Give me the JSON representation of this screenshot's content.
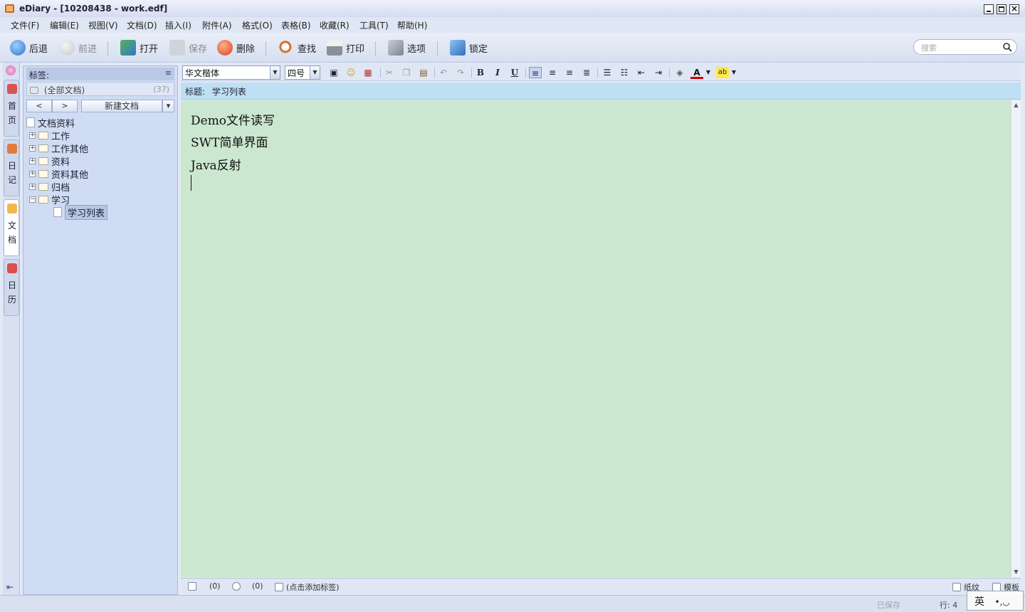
{
  "window": {
    "title": "eDiary - [10208438 - work.edf]"
  },
  "menu": [
    "文件(F)",
    "编辑(E)",
    "视图(V)",
    "文档(D)",
    "插入(I)",
    "附件(A)",
    "格式(O)",
    "表格(B)",
    "收藏(R)",
    "工具(T)",
    "帮助(H)"
  ],
  "toolbar": {
    "back": "后退",
    "forward": "前进",
    "open": "打开",
    "save": "保存",
    "delete": "删除",
    "find": "查找",
    "print": "打印",
    "options": "选项",
    "lock": "锁定",
    "search_placeholder": "搜索"
  },
  "left_tabs": {
    "home": "首页",
    "diary": "日记",
    "docs": "文档",
    "calendar": "日历"
  },
  "sidebar": {
    "tags_label": "标签:",
    "all_docs": "(全部文档)",
    "all_docs_count": "(37)",
    "nav_back": "<",
    "nav_forward": ">",
    "new_doc": "新建文档",
    "tree_root": "文档资料",
    "folders": [
      "工作",
      "工作其他",
      "资料",
      "资料其他",
      "归档",
      "学习"
    ],
    "selected_doc": "学习列表"
  },
  "editor_toolbar": {
    "font": "华文楷体",
    "size": "四号"
  },
  "doc": {
    "title_label": "标题:",
    "title": "学习列表",
    "lines": [
      "Demo文件读写",
      "SWT简单界面",
      "Java反射"
    ]
  },
  "doc_footer": {
    "attachments": "(0)",
    "comments": "(0)",
    "add_tag": "(点击添加标签)",
    "paper": "纸纹",
    "template": "模板"
  },
  "status": {
    "saved": "已保存",
    "line": "行: 4",
    "ime": "英"
  },
  "colors": {
    "editor_bg": "#cbe7cf",
    "title_bar_bg": "#bfe0f4",
    "sidebar_bg": "#cfdcf3"
  }
}
